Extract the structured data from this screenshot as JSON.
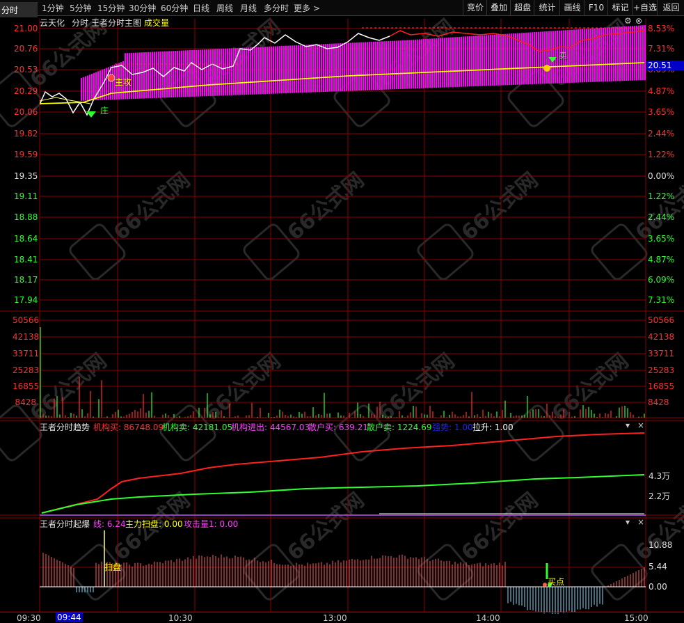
{
  "toolbar": {
    "timeframes": [
      "分时",
      "1分钟",
      "5分钟",
      "15分钟",
      "30分钟",
      "60分钟",
      "日线",
      "周线",
      "月线",
      "多分时",
      "更多 >"
    ],
    "right_buttons": [
      "竞价",
      "叠加",
      "超盘",
      "统计",
      "画线",
      "F10",
      "标记",
      "+自选",
      "返回"
    ]
  },
  "main_panel": {
    "stock_name": "云天化",
    "mode": "分时",
    "indicator_name": "王者分时主图",
    "volume_label": "成交量",
    "price_ticks": [
      "21.00",
      "20.76",
      "20.53",
      "20.29",
      "20.06",
      "19.82",
      "19.59",
      "19.35",
      "19.11",
      "18.88",
      "18.64",
      "18.41",
      "18.17",
      "17.94"
    ],
    "pct_ticks": [
      "8.53%",
      "7.31%",
      "6.09%",
      "4.87%",
      "3.65%",
      "2.44%",
      "1.22%",
      "0.00%",
      "1.22%",
      "2.44%",
      "3.65%",
      "4.87%",
      "6.09%",
      "7.31%"
    ],
    "current_price": "20.51",
    "signals": {
      "attack": "主攻",
      "bank": "庄",
      "sell": "卖"
    },
    "volume_ticks": [
      "50566",
      "42138",
      "33711",
      "25283",
      "16855",
      "8428"
    ]
  },
  "trend_panel": {
    "title": "王者分时趋势",
    "inst_buy_label": "机构买:",
    "inst_buy_value": "86748.09",
    "inst_sell_label": "机构卖:",
    "inst_sell_value": "42181.05",
    "inst_net_label": "机构进出:",
    "inst_net_value": "44567.03",
    "retail_buy_label": "散户买:",
    "retail_buy_value": "639.21",
    "retail_sell_label": "散户卖:",
    "retail_sell_value": "1224.69",
    "pull_label": "拉升:",
    "pull_value": "1.00",
    "hidden_label": "强势:",
    "hidden_value": "1.00",
    "axis_ticks": [
      "4.3万",
      "2.2万"
    ]
  },
  "burst_panel": {
    "title": "王者分时起爆",
    "line_label": "线:",
    "line_value": "6.24",
    "sweep_label": "主力扫盘:",
    "sweep_value": "0.00",
    "attack_label": "攻击量1:",
    "attack_value": "0.00",
    "axis_ticks": [
      "10.88",
      "5.44",
      "0.00"
    ],
    "sweep_marker": "扫盘",
    "buy_marker": "买点"
  },
  "time_axis": [
    "09:30",
    "09:44",
    "10:30",
    "13:00",
    "14:00",
    "15:00"
  ],
  "watermark": "66公式网",
  "colors": {
    "up": "#ff3030",
    "down": "#30ff30",
    "grid": "#8b0000",
    "magenta": "#ff00ff",
    "yellow": "#ffff00"
  }
}
